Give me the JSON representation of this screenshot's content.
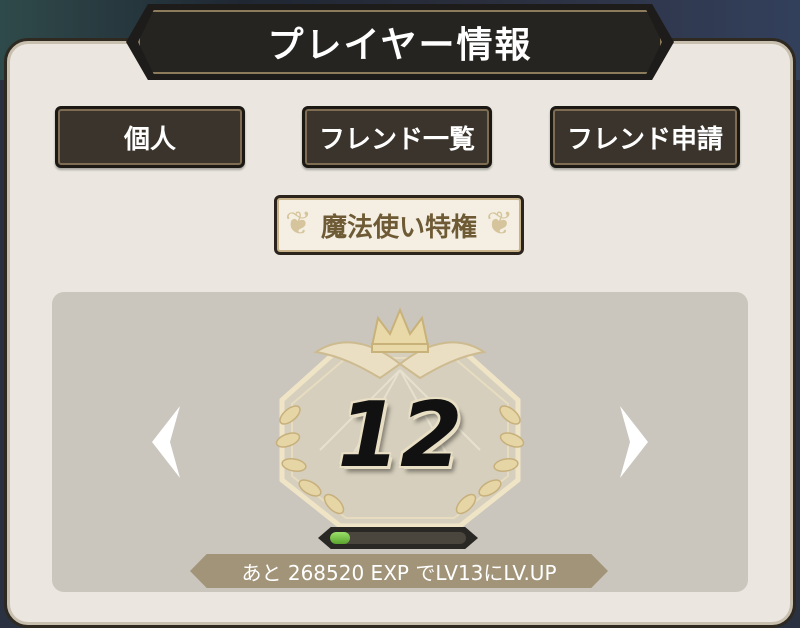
{
  "header": {
    "title": "プレイヤー情報"
  },
  "tabs": [
    {
      "label": "個人"
    },
    {
      "label": "フレンド一覧"
    },
    {
      "label": "フレンド申請"
    }
  ],
  "special_button": {
    "label": "魔法使い特権"
  },
  "level_card": {
    "level": "12",
    "exp_progress": 0.15,
    "exp_text": "あと 268520 EXP でLV13にLV.UP"
  },
  "icons": {
    "prev": "chevron-left-icon",
    "next": "chevron-right-icon",
    "badge": "crown-laurel-badge-icon"
  },
  "colors": {
    "panel_bg": "#ebe7e0",
    "tab_bg": "#3a342c",
    "special_bg": "#f4efe2",
    "special_text": "#6e5a35",
    "exp_fill": "#7cc44a"
  }
}
